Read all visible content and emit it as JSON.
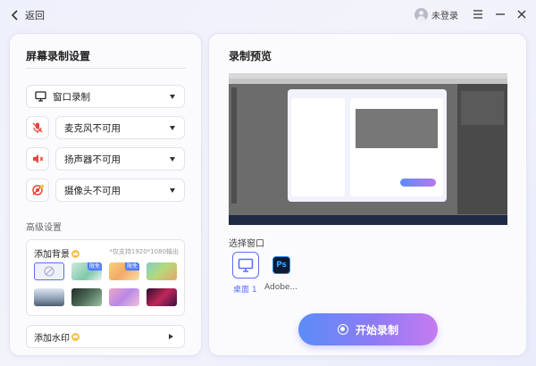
{
  "header": {
    "back_label": "返回",
    "user_label": "未登录"
  },
  "settings": {
    "title": "屏幕录制设置",
    "record_mode": "窗口录制",
    "microphone": "麦克风不可用",
    "speaker": "扬声器不可用",
    "camera": "摄像头不可用",
    "advanced_label": "高级设置",
    "background": {
      "title": "添加背景",
      "hint": "*仅支持1920*1080输出",
      "free_badge": "限免"
    },
    "watermark_label": "添加水印"
  },
  "preview": {
    "title": "录制预览",
    "select_window_label": "选择窗口",
    "windows": [
      {
        "label": "桌面 1",
        "icon": "monitor-icon",
        "selected": true
      },
      {
        "label": "Adobe...",
        "icon": "photoshop-icon",
        "selected": false
      }
    ],
    "ps_icon_text": "Ps",
    "start_button": "开始录制"
  },
  "colors": {
    "accent": "#5b6ef5",
    "danger": "#e8453c",
    "button_gradient_start": "#5b8cf8",
    "button_gradient_end": "#c57bf0"
  }
}
